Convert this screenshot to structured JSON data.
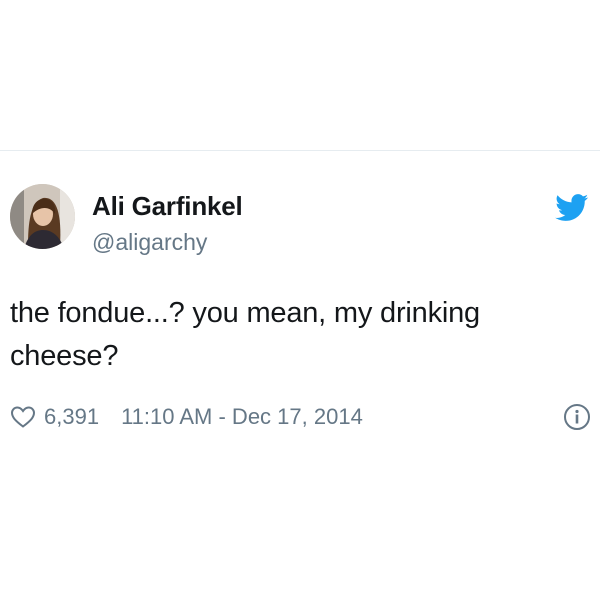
{
  "tweet": {
    "display_name": "Ali Garfinkel",
    "handle": "@aligarchy",
    "text": "the fondue...? you mean, my drinking cheese?",
    "like_count": "6,391",
    "timestamp": "11:10 AM - Dec 17, 2014"
  },
  "icons": {
    "avatar": "profile-photo",
    "logo": "twitter-bird-icon",
    "like": "heart-icon",
    "info": "info-icon"
  },
  "colors": {
    "brand": "#1da1f2",
    "secondary_text": "#657786",
    "primary_text": "#14171a",
    "divider": "#e6ecf0"
  }
}
